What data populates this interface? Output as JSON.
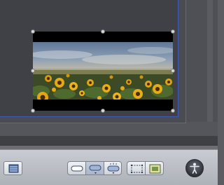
{
  "canvas": {
    "selected_media": "sunflower-field-video"
  },
  "toolbar": {
    "left_button_icon": "media-panel-icon",
    "shape_group": {
      "buttons": [
        {
          "icon": "rounded-rect-icon"
        },
        {
          "icon": "rounded-rect-drop-icon"
        },
        {
          "icon": "rounded-rect-glow-icon"
        }
      ]
    },
    "frame_group": {
      "buttons": [
        {
          "icon": "crop-frame-icon"
        },
        {
          "icon": "picture-frame-icon"
        }
      ]
    },
    "right_button_icon": "accessibility-person-icon"
  },
  "colors": {
    "selection_border": "#4a67c9",
    "toolbar_bg": "#b8bcc3"
  }
}
